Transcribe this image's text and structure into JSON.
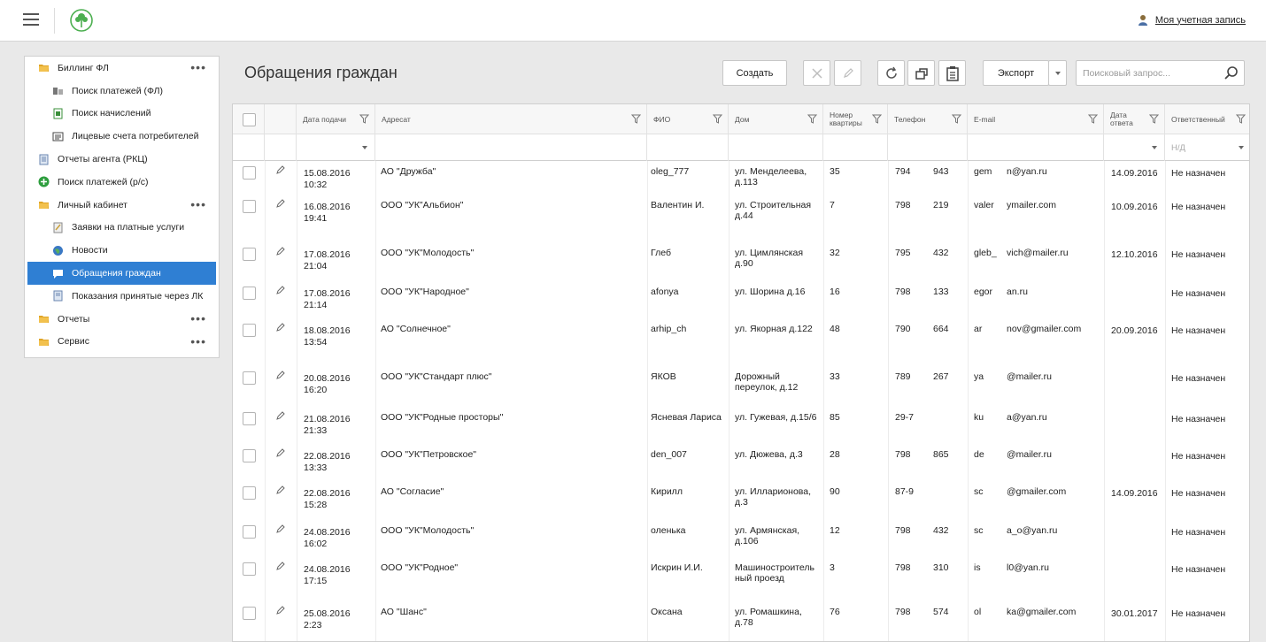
{
  "header": {
    "menu_icon": "hamburger-icon",
    "logo_icon": "tree-logo-icon",
    "account_label": "Моя учетная запись",
    "account_icon": "user-icon"
  },
  "sidebar": {
    "items": [
      {
        "label": "Биллинг ФЛ",
        "icon": "folder-icon",
        "level": 0,
        "more": true
      },
      {
        "label": "Поиск платежей (ФЛ)",
        "icon": "payments-icon",
        "level": 1
      },
      {
        "label": "Поиск начислений",
        "icon": "accruals-icon",
        "level": 1
      },
      {
        "label": "Лицевые счета потребителей",
        "icon": "accounts-icon",
        "level": 1
      },
      {
        "label": "Отчеты агента (РКЦ)",
        "icon": "report-icon",
        "level": 0
      },
      {
        "label": "Поиск платежей (р/с)",
        "icon": "plus-circle-icon",
        "level": 0
      },
      {
        "label": "Личный кабинет",
        "icon": "folder-icon",
        "level": 0,
        "more": true
      },
      {
        "label": "Заявки на платные услуги",
        "icon": "request-icon",
        "level": 1
      },
      {
        "label": "Новости",
        "icon": "globe-icon",
        "level": 1
      },
      {
        "label": "Обращения граждан",
        "icon": "chat-icon",
        "level": 1,
        "active": true
      },
      {
        "label": "Показания принятые через ЛК",
        "icon": "readings-icon",
        "level": 1
      },
      {
        "label": "Отчеты",
        "icon": "folder-icon",
        "level": 0,
        "more": true
      },
      {
        "label": "Сервис",
        "icon": "folder-icon",
        "level": 0,
        "more": true
      }
    ]
  },
  "main": {
    "title": "Обращения граждан",
    "toolbar": {
      "create_label": "Создать",
      "export_label": "Экспорт",
      "search_placeholder": "Поисковый запрос..."
    },
    "columns": {
      "date": "Дата подачи",
      "addressee": "Адресат",
      "fio": "ФИО",
      "house": "Дом",
      "flat_1": "Номер",
      "flat_2": "квартиры",
      "phone": "Телефон",
      "email": "E-mail",
      "answer_1": "Дата",
      "answer_2": "ответа",
      "responsible": "Ответственный"
    },
    "filters": {
      "responsible_placeholder": "Н/Д"
    },
    "rows": [
      {
        "date1": "15.08.2016",
        "date2": "10:32",
        "addr": "АО \"Дружба\"",
        "fio": "oleg_777",
        "house1": "ул. Менделеева,",
        "house2": "д.113",
        "flat": "35",
        "ph1": "794",
        "ph2": "943",
        "em1": "gem",
        "em2": "n@yan.ru",
        "ans": "14.09.2016",
        "resp": "Не назначен"
      },
      {
        "date1": "16.08.2016",
        "date2": "19:41",
        "addr": "ООО \"УК\"Альбион\"",
        "fio": "Валентин И.",
        "house1": "ул. Строительная",
        "house2": "д.44",
        "flat": "7",
        "ph1": "798",
        "ph2": "219",
        "em1": "valer",
        "em2": "ymailer.com",
        "ans": "10.09.2016",
        "resp": "Не назначен"
      },
      {
        "date1": "17.08.2016",
        "date2": "21:04",
        "addr": "ООО \"УК\"Молодость\"",
        "fio": "Глеб",
        "house1": "ул. Цимлянская",
        "house2": "д.90",
        "flat": "32",
        "ph1": "795",
        "ph2": "432",
        "em1": "gleb_",
        "em2": "vich@mailer.ru",
        "ans": "12.10.2016",
        "resp": "Не назначен"
      },
      {
        "date1": "17.08.2016",
        "date2": "21:14",
        "addr": "ООО \"УК\"Народное\"",
        "fio": "afonya",
        "house1": "ул. Шорина д.16",
        "house2": "",
        "flat": "16",
        "ph1": "798",
        "ph2": "133",
        "em1": "egor",
        "em2": "an.ru",
        "ans": "",
        "resp": "Не назначен"
      },
      {
        "date1": "18.08.2016",
        "date2": "13:54",
        "addr": "АО \"Солнечное\"",
        "fio": "arhip_ch",
        "house1": "ул. Якорная д.122",
        "house2": "",
        "flat": "48",
        "ph1": "790",
        "ph2": "664",
        "em1": "ar",
        "em2": "nov@gmailer.com",
        "ans": "20.09.2016",
        "resp": "Не назначен"
      },
      {
        "date1": "20.08.2016",
        "date2": "16:20",
        "addr": "ООО \"УК\"Стандарт плюс\"",
        "fio": "ЯКОВ",
        "house1": "Дорожный",
        "house2": "переулок, д.12",
        "flat": "33",
        "ph1": "789",
        "ph2": "267",
        "em1": "ya",
        "em2": "@mailer.ru",
        "ans": "",
        "resp": "Не назначен"
      },
      {
        "date1": "21.08.2016",
        "date2": "21:33",
        "addr": "ООО \"УК\"Родные просторы\"",
        "fio": "Ясневая Лариса",
        "house1": "ул. Гужевая, д.15/6",
        "house2": "",
        "flat": "85",
        "ph1": "29-7",
        "ph2": "",
        "em1": "ku",
        "em2": "a@yan.ru",
        "ans": "",
        "resp": "Не назначен"
      },
      {
        "date1": "22.08.2016",
        "date2": "13:33",
        "addr": "ООО \"УК\"Петровское\"",
        "fio": "den_007",
        "house1": "ул. Дюжева, д.3",
        "house2": "",
        "flat": "28",
        "ph1": "798",
        "ph2": "865",
        "em1": "de",
        "em2": "@mailer.ru",
        "ans": "",
        "resp": "Не назначен"
      },
      {
        "date1": "22.08.2016",
        "date2": "15:28",
        "addr": "АО \"Согласие\"",
        "fio": "Кирилл",
        "house1": "ул. Илларионова,",
        "house2": "д.3",
        "flat": "90",
        "ph1": "87-9",
        "ph2": "",
        "em1": "sc",
        "em2": "@gmailer.com",
        "ans": "14.09.2016",
        "resp": "Не назначен"
      },
      {
        "date1": "24.08.2016",
        "date2": "16:02",
        "addr": "ООО \"УК\"Молодость\"",
        "fio": "оленька",
        "house1": "ул. Армянская,",
        "house2": "д.106",
        "flat": "12",
        "ph1": "798",
        "ph2": "432",
        "em1": "sc",
        "em2": "a_o@yan.ru",
        "ans": "",
        "resp": "Не назначен"
      },
      {
        "date1": "24.08.2016",
        "date2": "17:15",
        "addr": "ООО \"УК\"Родное\"",
        "fio": "Искрин И.И.",
        "house1": "Машиностроитель",
        "house2": "ный проезд",
        "flat": "3",
        "ph1": "798",
        "ph2": "310",
        "em1": "is",
        "em2": "l0@yan.ru",
        "ans": "",
        "resp": "Не назначен"
      },
      {
        "date1": "25.08.2016",
        "date2": "2:23",
        "addr": "АО \"Шанс\"",
        "fio": "Оксана",
        "house1": "ул. Ромашкина,",
        "house2": "д.78",
        "flat": "76",
        "ph1": "798",
        "ph2": "574",
        "em1": "ol",
        "em2": "ka@gmailer.com",
        "ans": "30.01.2017",
        "resp": "Не назначен"
      }
    ]
  },
  "colors": {
    "accent": "#2f7fd3",
    "logo": "#4caf50",
    "folder": "#e0a526"
  }
}
